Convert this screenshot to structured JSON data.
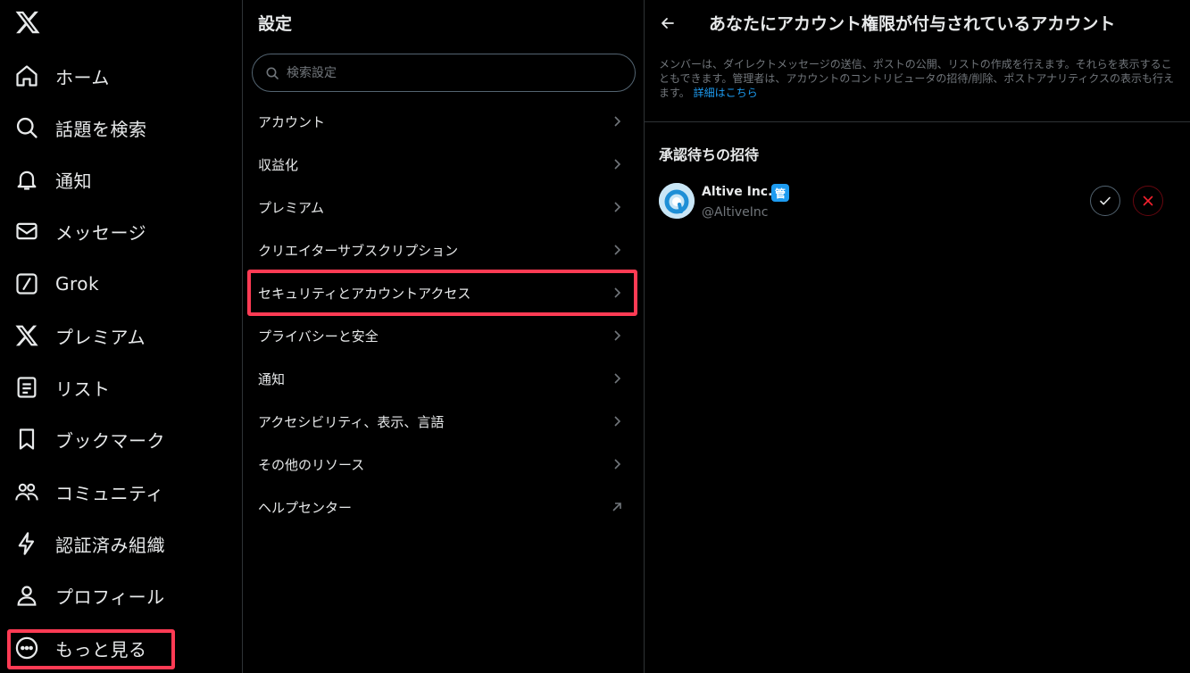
{
  "sidebar": {
    "items": [
      {
        "label": "ホーム",
        "icon": "home-icon"
      },
      {
        "label": "話題を検索",
        "icon": "search-icon"
      },
      {
        "label": "通知",
        "icon": "bell-icon"
      },
      {
        "label": "メッセージ",
        "icon": "mail-icon"
      },
      {
        "label": "Grok",
        "icon": "grok-icon"
      },
      {
        "label": "プレミアム",
        "icon": "x-logo-icon"
      },
      {
        "label": "リスト",
        "icon": "list-icon"
      },
      {
        "label": "ブックマーク",
        "icon": "bookmark-icon"
      },
      {
        "label": "コミュニティ",
        "icon": "community-icon"
      },
      {
        "label": "認証済み組織",
        "icon": "lightning-icon"
      },
      {
        "label": "プロフィール",
        "icon": "person-icon"
      },
      {
        "label": "もっと見る",
        "icon": "more-icon"
      }
    ]
  },
  "settings": {
    "title": "設定",
    "search_placeholder": "検索設定",
    "items": [
      {
        "label": "アカウント",
        "icon": "chevron-right-icon"
      },
      {
        "label": "収益化",
        "icon": "chevron-right-icon"
      },
      {
        "label": "プレミアム",
        "icon": "chevron-right-icon"
      },
      {
        "label": "クリエイターサブスクリプション",
        "icon": "chevron-right-icon"
      },
      {
        "label": "セキュリティとアカウントアクセス",
        "icon": "chevron-right-icon"
      },
      {
        "label": "プライバシーと安全",
        "icon": "chevron-right-icon"
      },
      {
        "label": "通知",
        "icon": "chevron-right-icon"
      },
      {
        "label": "アクセシビリティ、表示、言語",
        "icon": "chevron-right-icon"
      },
      {
        "label": "その他のリソース",
        "icon": "chevron-right-icon"
      },
      {
        "label": "ヘルプセンター",
        "icon": "external-link-icon"
      }
    ]
  },
  "panel": {
    "title": "あなたにアカウント権限が付与されているアカウント",
    "description": "メンバーは、ダイレクトメッセージの送信、ポストの公開、リストの作成を行えます。それらを表示することもできます。管理者は、アカウントのコントリビュータの招待/削除、ポストアナリティクスの表示も行えます。",
    "learn_more": "詳細はこちら",
    "section_title": "承認待ちの招待",
    "invite": {
      "name": "Altive Inc.",
      "badge": "管",
      "handle": "@AltiveInc"
    }
  },
  "colors": {
    "background": "#000000",
    "text": "#e7e9ea",
    "muted": "#71767b",
    "accent": "#1d9bf0",
    "highlight": "#ff3b54",
    "danger": "#f4212e"
  }
}
